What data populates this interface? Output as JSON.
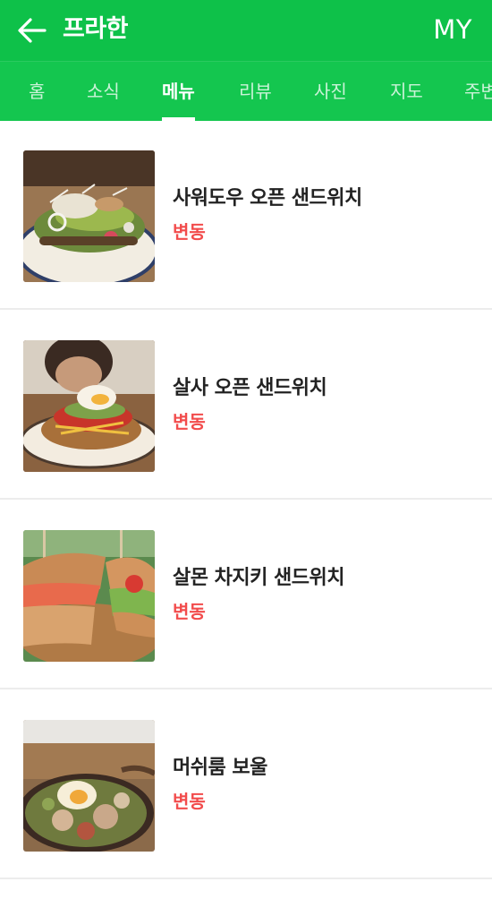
{
  "header": {
    "title": "프라한",
    "my_label": "MY"
  },
  "tabs": [
    {
      "label": "홈"
    },
    {
      "label": "소식"
    },
    {
      "label": "메뉴",
      "active": true
    },
    {
      "label": "리뷰"
    },
    {
      "label": "사진"
    },
    {
      "label": "지도"
    },
    {
      "label": "주변"
    }
  ],
  "menu": {
    "items": [
      {
        "name": "사워도우 오픈 샌드위치",
        "price": "변동"
      },
      {
        "name": "살사 오픈 샌드위치",
        "price": "변동"
      },
      {
        "name": "살몬 차지키 샌드위치",
        "price": "변동"
      },
      {
        "name": "머쉬룸 보울",
        "price": "변동"
      }
    ]
  },
  "colors": {
    "brand_green": "#0ec149",
    "tab_green": "#14c64f",
    "price_red": "#f24c4c",
    "text_dark": "#222222"
  }
}
